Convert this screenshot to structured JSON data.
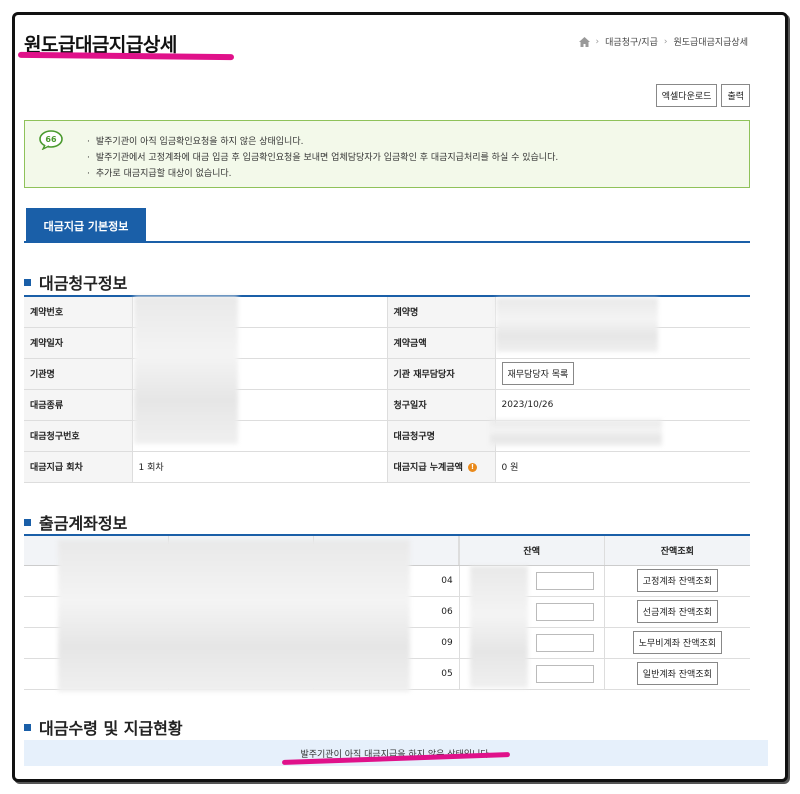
{
  "page": {
    "title": "원도급대금지급상세"
  },
  "breadcrumb": {
    "items": [
      "대금청구/지급",
      "원도급대금지급상세"
    ]
  },
  "toolbar": {
    "excel_label": "엑셀다운로드",
    "print_label": "출력"
  },
  "notice": {
    "lines": [
      "발주기관이 아직 입금확인요청을 하지 않은 상태입니다.",
      "발주기관에서 고정계좌에 대금 입금 후 입금확인요청을 보내면 업체담당자가 입금확인 후 대금지급처리를 하실 수 있습니다.",
      "추가로 대금지급할 대상이 없습니다."
    ]
  },
  "tabs": [
    {
      "label": "대금지급 기본정보"
    }
  ],
  "billing_section": {
    "title": "대금청구정보",
    "rows": [
      {
        "label1": "계약번호",
        "value1": "",
        "label2": "계약명",
        "value2": ""
      },
      {
        "label1": "계약일자",
        "value1": "",
        "label2": "계약금액",
        "value2": ""
      },
      {
        "label1": "기관명",
        "value1": "",
        "label2": "기관 재무담당자",
        "value2": ""
      },
      {
        "label1": "대금종류",
        "value1": "",
        "label2": "청구일자",
        "value2": "2023/10/26"
      },
      {
        "label1": "대금청구번호",
        "value1": "",
        "label2": "대금청구명",
        "value2": ""
      },
      {
        "label1": "대금지급 회차",
        "value1": "1 회차",
        "label2": "대금지급 누계금액",
        "value2": "0 원"
      }
    ],
    "finance_button_label": "재무담당자 목록"
  },
  "account_section": {
    "title": "출금계좌정보",
    "headers": [
      "",
      "",
      "",
      "",
      "잔액",
      "잔액조회"
    ],
    "rows": [
      {
        "acct_suffix": "04",
        "button_label": "고정계좌 잔액조회"
      },
      {
        "acct_suffix": "06",
        "button_label": "선금계좌 잔액조회"
      },
      {
        "acct_suffix": "09",
        "button_label": "노무비계좌 잔액조회"
      },
      {
        "acct_suffix": "05",
        "button_label": "일반계좌 잔액조회"
      }
    ]
  },
  "payment_section": {
    "title": "대금수령 및 지급현황",
    "status_text": "발주기관이 아직 대금지급을 하지 않은 상태입니다."
  },
  "colors": {
    "accent": "#1a5fa8",
    "highlight": "#e0118a",
    "notice_border": "#8fc25a"
  }
}
